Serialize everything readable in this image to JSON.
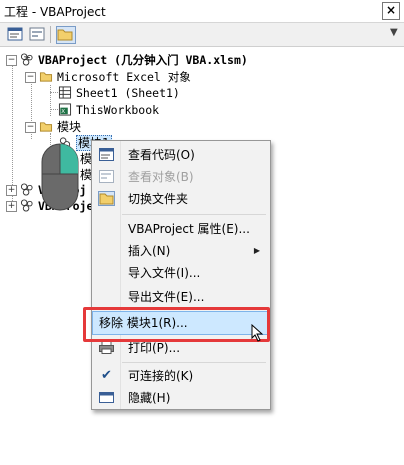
{
  "window": {
    "title": "工程 - VBAProject",
    "close_glyph": "×"
  },
  "toolbar": {
    "buttons": [
      {
        "name": "view-code-button",
        "icon": "view-code-icon"
      },
      {
        "name": "view-object-button",
        "icon": "view-object-icon"
      },
      {
        "name": "toggle-folders-button",
        "icon": "folder-icon",
        "active": true
      }
    ],
    "more_glyph": "▼"
  },
  "tree": {
    "project1": {
      "label": "VBAProject (几分钟入门 VBA.xlsm)",
      "expander": "−"
    },
    "excel_objects": {
      "label": "Microsoft Excel 对象",
      "expander": "−"
    },
    "sheet1": {
      "label": "Sheet1 (Sheet1)"
    },
    "thisworkbook": {
      "label": "ThisWorkbook"
    },
    "modules": {
      "label": "模块",
      "expander": "−"
    },
    "module1": {
      "label": "模块1"
    },
    "module2": {
      "label": "模"
    },
    "module3": {
      "label": "模"
    },
    "project2": {
      "label": "VBAProj",
      "expander": "+"
    },
    "project3": {
      "label": "VBAProje",
      "expander": "+"
    }
  },
  "menu": {
    "items": [
      {
        "label": "查看代码(O)",
        "icon": "view-code-icon",
        "disabled": false
      },
      {
        "label": "查看对象(B)",
        "icon": "view-object-icon",
        "disabled": true
      },
      {
        "label": "切换文件夹",
        "icon": "folder-icon",
        "disabled": false
      },
      {
        "label": "VBAProject 属性(E)...",
        "icon": "",
        "disabled": false
      },
      {
        "label": "插入(N)",
        "icon": "",
        "disabled": false,
        "submenu": true
      },
      {
        "label": "导入文件(I)...",
        "icon": "",
        "disabled": false
      },
      {
        "label": "导出文件(E)...",
        "icon": "",
        "disabled": false
      },
      {
        "label": "移除 模块1(R)...",
        "icon": "",
        "disabled": false,
        "highlighted": true
      },
      {
        "label": "打印(P)...",
        "icon": "print-icon",
        "disabled": false
      },
      {
        "label": "可连接的(K)",
        "icon": "check-icon",
        "disabled": false
      },
      {
        "label": "隐藏(H)",
        "icon": "hide-icon",
        "disabled": false
      }
    ],
    "submenu_arrow": "▶"
  },
  "colors": {
    "highlight": "#cde8ff",
    "annotation_box": "#e5393a",
    "mouse_teal": "#3fb9a0"
  }
}
